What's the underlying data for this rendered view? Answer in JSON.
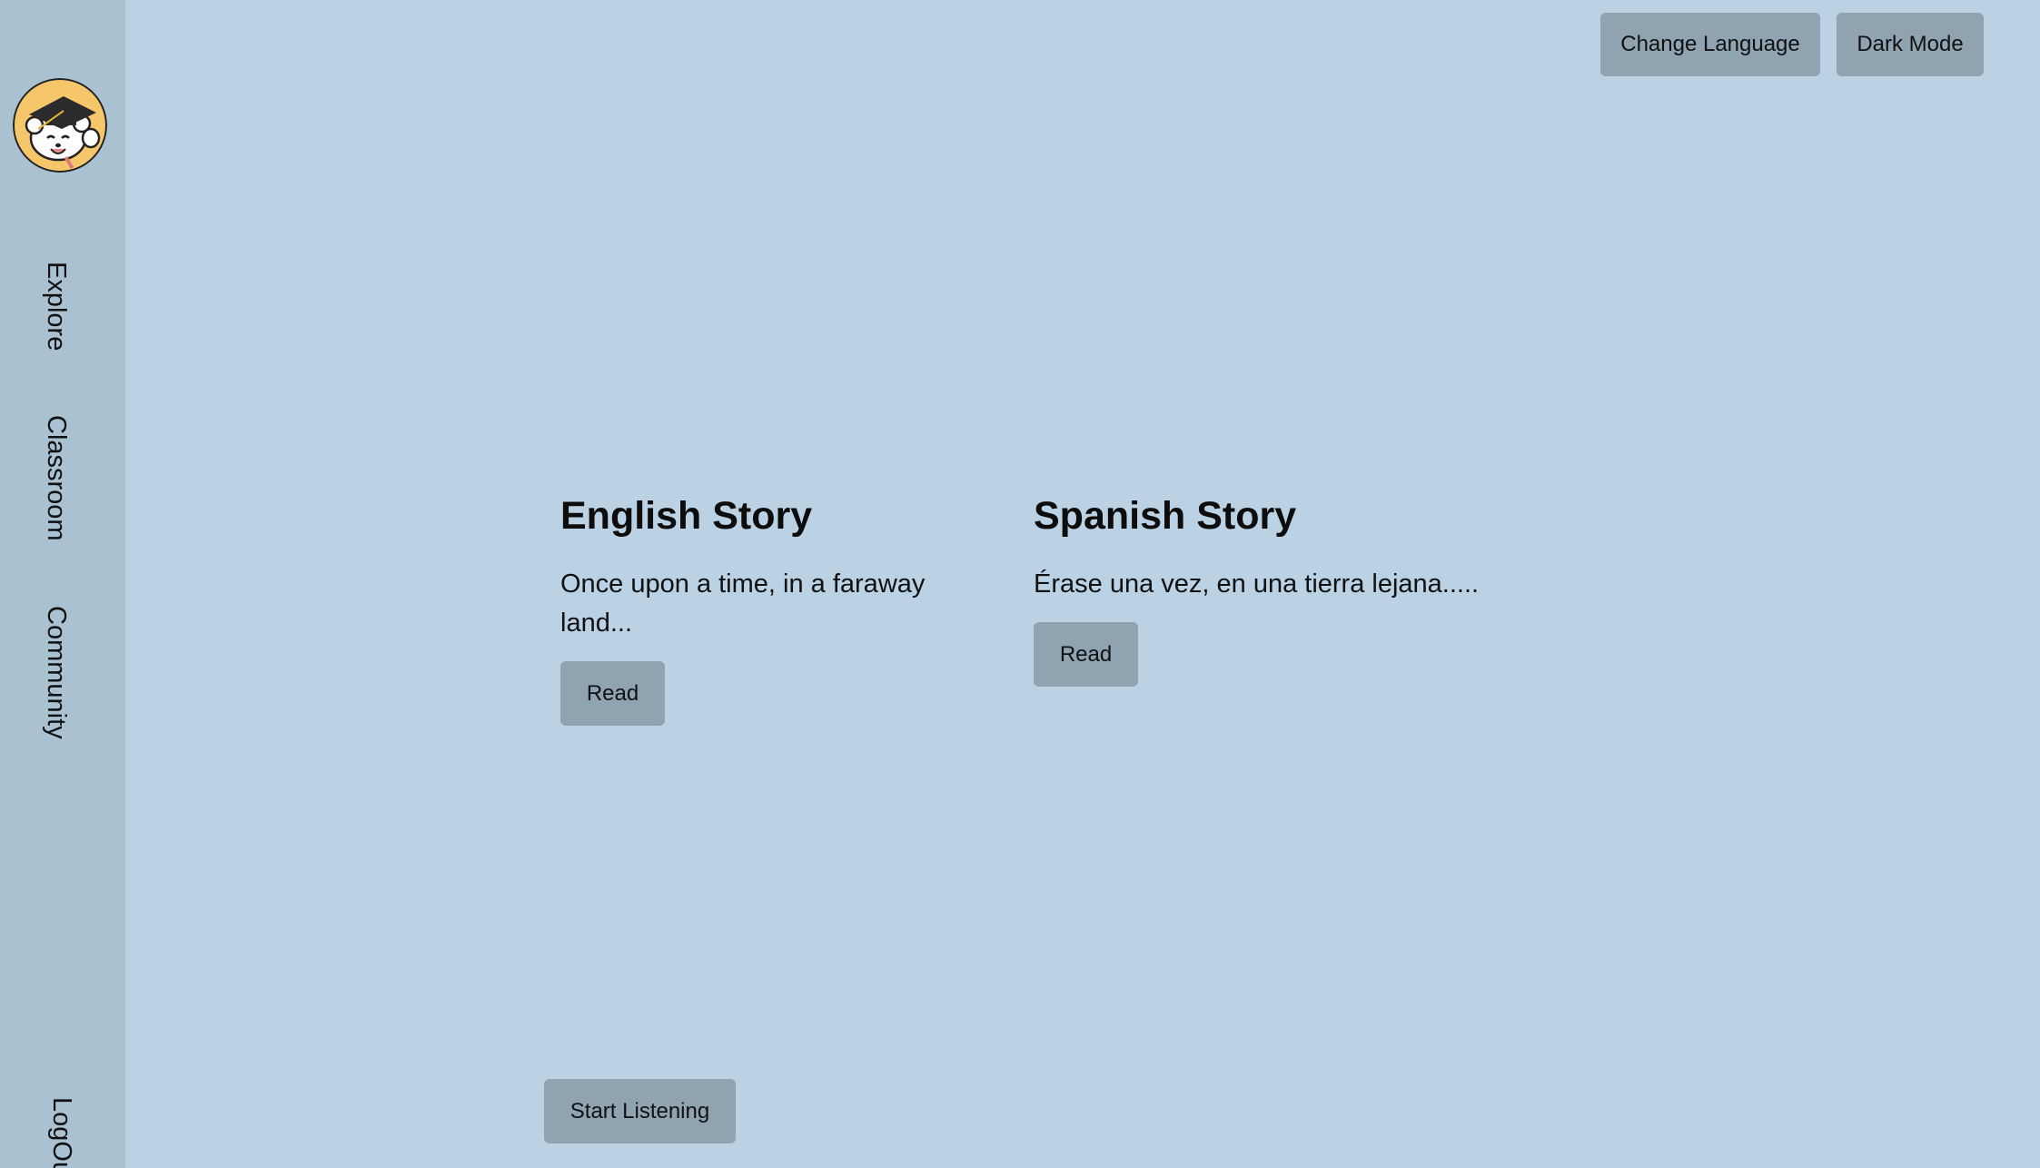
{
  "sidebar": {
    "avatar_icon": "graduate-bear-icon",
    "items": [
      {
        "label": "Explore"
      },
      {
        "label": "Classroom"
      },
      {
        "label": "Community"
      }
    ],
    "logout_label": "LogOut"
  },
  "header": {
    "change_language_label": "Change Language",
    "dark_mode_label": "Dark Mode"
  },
  "stories": [
    {
      "title": "English Story",
      "text": "Once upon a time, in a faraway land...",
      "read_label": "Read"
    },
    {
      "title": "Spanish Story",
      "text": "Érase una vez, en una tierra lejana.....",
      "read_label": "Read"
    }
  ],
  "footer": {
    "start_listening_label": "Start Listening"
  },
  "colors": {
    "background": "#bbd2e4",
    "sidebar": "#a9c1d0",
    "button": "#8fa3b1",
    "avatar_bg": "#f6c66a"
  }
}
